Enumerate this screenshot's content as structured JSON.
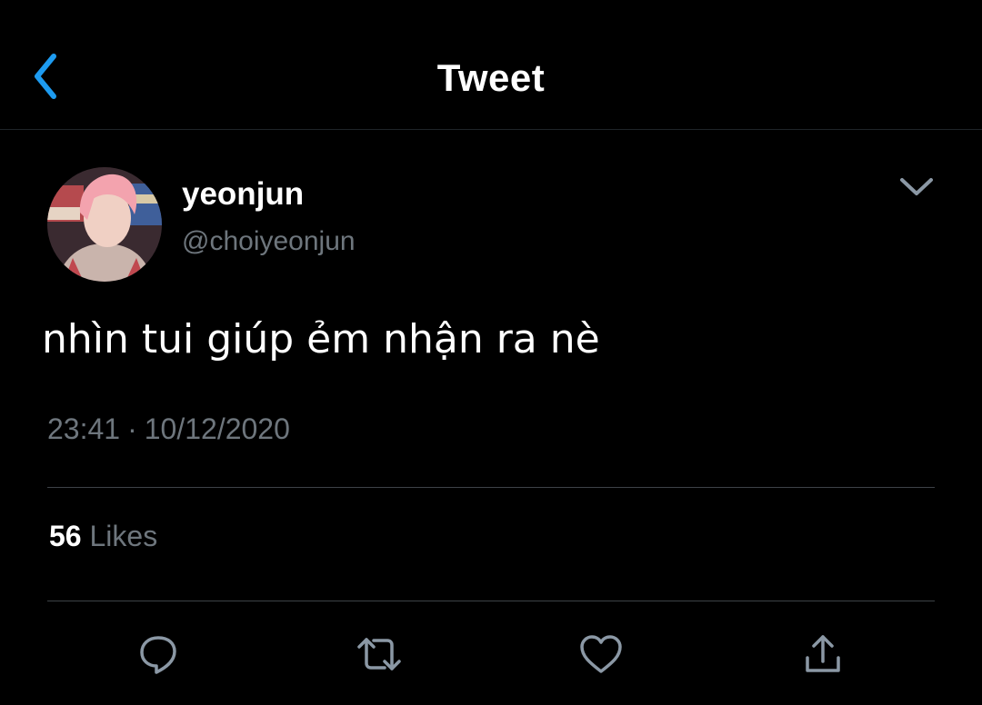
{
  "header": {
    "title": "Tweet",
    "back_icon": "chevron-left-icon"
  },
  "colors": {
    "background": "#000000",
    "accent": "#1d9bf0",
    "text_primary": "#ffffff",
    "text_secondary": "#6e767d",
    "divider": "#3d4247",
    "icon": "#8b98a5"
  },
  "tweet": {
    "author": {
      "display_name": "yeonjun",
      "handle": "@choiyeonjun"
    },
    "text": "nhìn tui giúp ẻm nhận ra nè",
    "time": "23:41",
    "separator": "·",
    "date": "10/12/2020",
    "likes_count": "56",
    "likes_label": "Likes",
    "menu_icon": "chevron-down-icon"
  },
  "actions": [
    {
      "name": "reply",
      "icon": "comment-icon"
    },
    {
      "name": "retweet",
      "icon": "retweet-icon"
    },
    {
      "name": "like",
      "icon": "heart-icon"
    },
    {
      "name": "share",
      "icon": "share-icon"
    }
  ]
}
